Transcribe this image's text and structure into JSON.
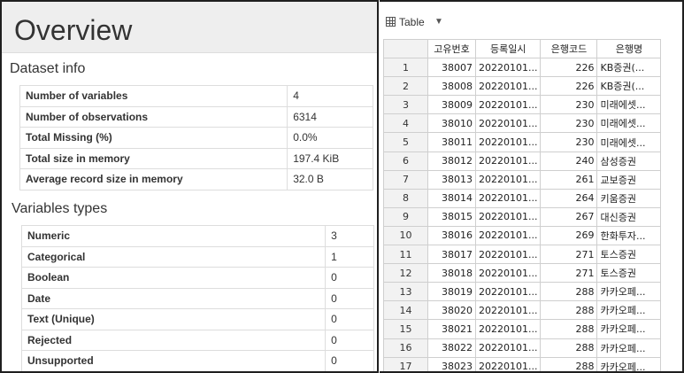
{
  "overview": {
    "title": "Overview",
    "dataset_info_title": "Dataset info",
    "dataset_info": [
      {
        "label": "Number of variables",
        "value": "4"
      },
      {
        "label": "Number of observations",
        "value": "6314"
      },
      {
        "label": "Total Missing (%)",
        "value": "0.0%"
      },
      {
        "label": "Total size in memory",
        "value": "197.4 KiB"
      },
      {
        "label": "Average record size in memory",
        "value": "32.0 B"
      }
    ],
    "variable_types_title": "Variables types",
    "variable_types": [
      {
        "label": "Numeric",
        "value": "3"
      },
      {
        "label": "Categorical",
        "value": "1"
      },
      {
        "label": "Boolean",
        "value": "0"
      },
      {
        "label": "Date",
        "value": "0"
      },
      {
        "label": "Text (Unique)",
        "value": "0"
      },
      {
        "label": "Rejected",
        "value": "0"
      },
      {
        "label": "Unsupported",
        "value": "0"
      }
    ]
  },
  "table_view": {
    "toolbar_label": "Table",
    "icons": {
      "view": "table-grid-icon",
      "dropdown": "chevron-down-icon"
    },
    "columns": [
      "고유번호",
      "등록일시",
      "은행코드",
      "은행명"
    ],
    "rows": [
      {
        "n": "1",
        "id": "38007",
        "date": "20220101...",
        "code": "226",
        "name": "KB증권(..."
      },
      {
        "n": "2",
        "id": "38008",
        "date": "20220101...",
        "code": "226",
        "name": "KB증권(..."
      },
      {
        "n": "3",
        "id": "38009",
        "date": "20220101...",
        "code": "230",
        "name": "미래에셋..."
      },
      {
        "n": "4",
        "id": "38010",
        "date": "20220101...",
        "code": "230",
        "name": "미래에셋..."
      },
      {
        "n": "5",
        "id": "38011",
        "date": "20220101...",
        "code": "230",
        "name": "미래에셋..."
      },
      {
        "n": "6",
        "id": "38012",
        "date": "20220101...",
        "code": "240",
        "name": "삼성증권"
      },
      {
        "n": "7",
        "id": "38013",
        "date": "20220101...",
        "code": "261",
        "name": "교보증권"
      },
      {
        "n": "8",
        "id": "38014",
        "date": "20220101...",
        "code": "264",
        "name": "키움증권"
      },
      {
        "n": "9",
        "id": "38015",
        "date": "20220101...",
        "code": "267",
        "name": "대신증권"
      },
      {
        "n": "10",
        "id": "38016",
        "date": "20220101...",
        "code": "269",
        "name": "한화투자..."
      },
      {
        "n": "11",
        "id": "38017",
        "date": "20220101...",
        "code": "271",
        "name": "토스증권"
      },
      {
        "n": "12",
        "id": "38018",
        "date": "20220101...",
        "code": "271",
        "name": "토스증권"
      },
      {
        "n": "13",
        "id": "38019",
        "date": "20220101...",
        "code": "288",
        "name": "카카오페..."
      },
      {
        "n": "14",
        "id": "38020",
        "date": "20220101...",
        "code": "288",
        "name": "카카오페..."
      },
      {
        "n": "15",
        "id": "38021",
        "date": "20220101...",
        "code": "288",
        "name": "카카오페..."
      },
      {
        "n": "16",
        "id": "38022",
        "date": "20220101...",
        "code": "288",
        "name": "카카오페..."
      },
      {
        "n": "17",
        "id": "38023",
        "date": "20220101...",
        "code": "288",
        "name": "카카오페..."
      }
    ]
  }
}
